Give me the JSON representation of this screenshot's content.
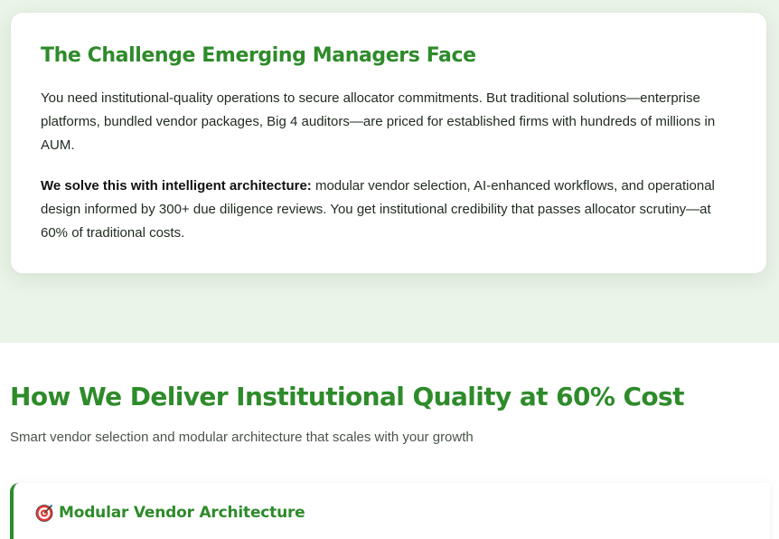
{
  "challenge": {
    "title": "The Challenge Emerging Managers Face",
    "paragraph1": "You need institutional-quality operations to secure allocator commitments. But traditional solutions—enterprise platforms, bundled vendor packages, Big 4 auditors—are priced for established firms with hundreds of millions in AUM.",
    "paragraph2_lead": "We solve this with intelligent architecture:",
    "paragraph2_rest": " modular vendor selection, AI-enhanced workflows, and operational design informed by 300+ due diligence reviews. You get institutional credibility that passes allocator scrutiny—at 60% of traditional costs."
  },
  "deliver": {
    "title": "How We Deliver Institutional Quality at 60% Cost",
    "subtitle": "Smart vendor selection and modular architecture that scales with your growth",
    "feature": {
      "icon": "target-icon",
      "title": "Modular Vendor Architecture"
    }
  },
  "colors": {
    "accent_green": "#2e8b2a",
    "band_background": "#eaf4e8",
    "body_text": "#1f2a1f",
    "muted_text": "#4a554a"
  }
}
